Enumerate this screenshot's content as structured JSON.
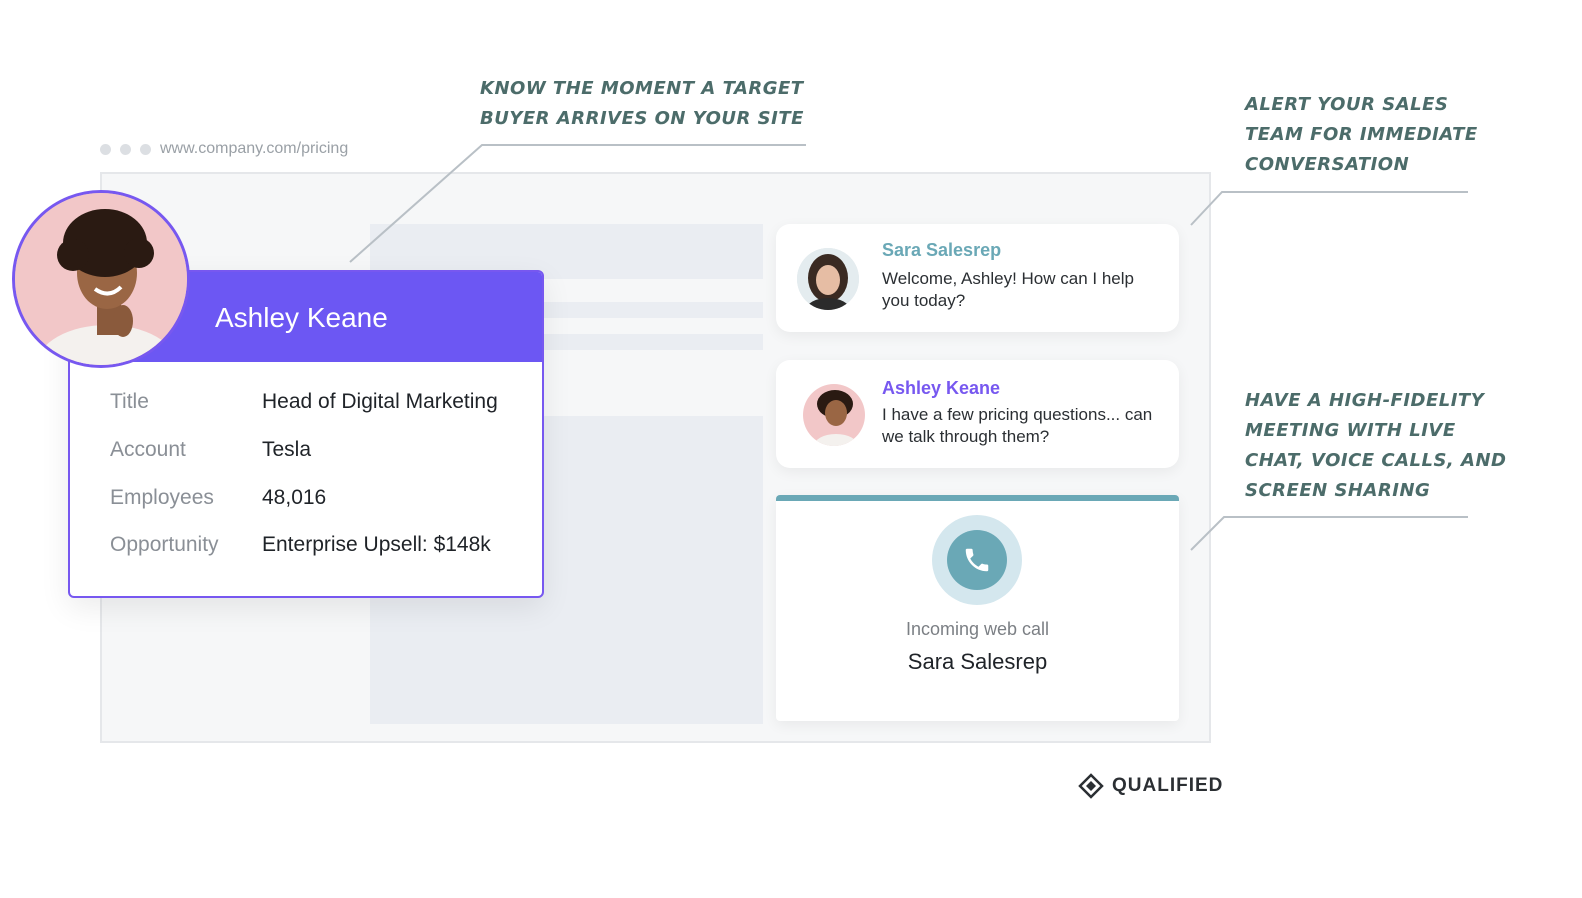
{
  "browser": {
    "url": "www.company.com/pricing"
  },
  "annotations": {
    "arrival": [
      "Know the moment a target",
      "buyer arrives on your site"
    ],
    "alert": [
      "Alert your sales",
      "team for immediate",
      "conversation"
    ],
    "meeting": [
      "Have a high-fidelity",
      "meeting with live",
      "chat, voice calls, and",
      "screen sharing"
    ]
  },
  "profile": {
    "name": "Ashley Keane",
    "rows": [
      {
        "label": "Title",
        "value": "Head of Digital Marketing"
      },
      {
        "label": "Account",
        "value": "Tesla"
      },
      {
        "label": "Employees",
        "value": "48,016"
      },
      {
        "label": "Opportunity",
        "value": "Enterprise Upsell: $148k"
      }
    ]
  },
  "chat": [
    {
      "sender": "Sara Salesrep",
      "message": "Welcome, Ashley! How can I help you today?",
      "name_color": "#6aa8b6"
    },
    {
      "sender": "Ashley Keane",
      "message": "I have a few pricing questions... can we talk through them?",
      "name_color": "#7758f0"
    }
  ],
  "call": {
    "label": "Incoming web call",
    "caller": "Sara Salesrep",
    "icon": "phone-icon"
  },
  "brand": {
    "name": "QUALIFIED"
  },
  "colors": {
    "accent_purple": "#6c57f3",
    "accent_teal": "#6aa8b6",
    "annotation": "#4c6c6a"
  }
}
